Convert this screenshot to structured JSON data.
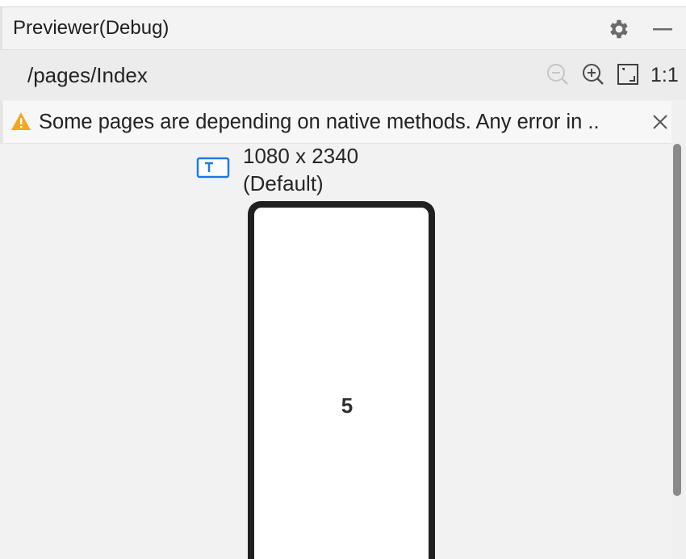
{
  "window": {
    "title": "Previewer(Debug)",
    "icons": {
      "settings": "gear-icon",
      "minimize": "minimize-icon"
    }
  },
  "toolbar": {
    "path": "/pages/Index",
    "zoom_out_icon": "zoom-out-icon",
    "zoom_in_icon": "zoom-in-icon",
    "fit_icon": "fit-screen-icon",
    "actual_size_label": "1:1"
  },
  "banner": {
    "text": "Some pages are depending on native methods. Any error in ..",
    "icon": "warning-icon",
    "close_icon": "close-icon"
  },
  "device": {
    "resolution": "1080 x 2340",
    "profile": "(Default)",
    "icon": "text-device-icon",
    "screen_text": "5"
  },
  "colors": {
    "accent": "#1f7ae6",
    "warning": "#f5a623",
    "scrollbar": "#8a8a8a",
    "phone_frame": "#202020"
  }
}
